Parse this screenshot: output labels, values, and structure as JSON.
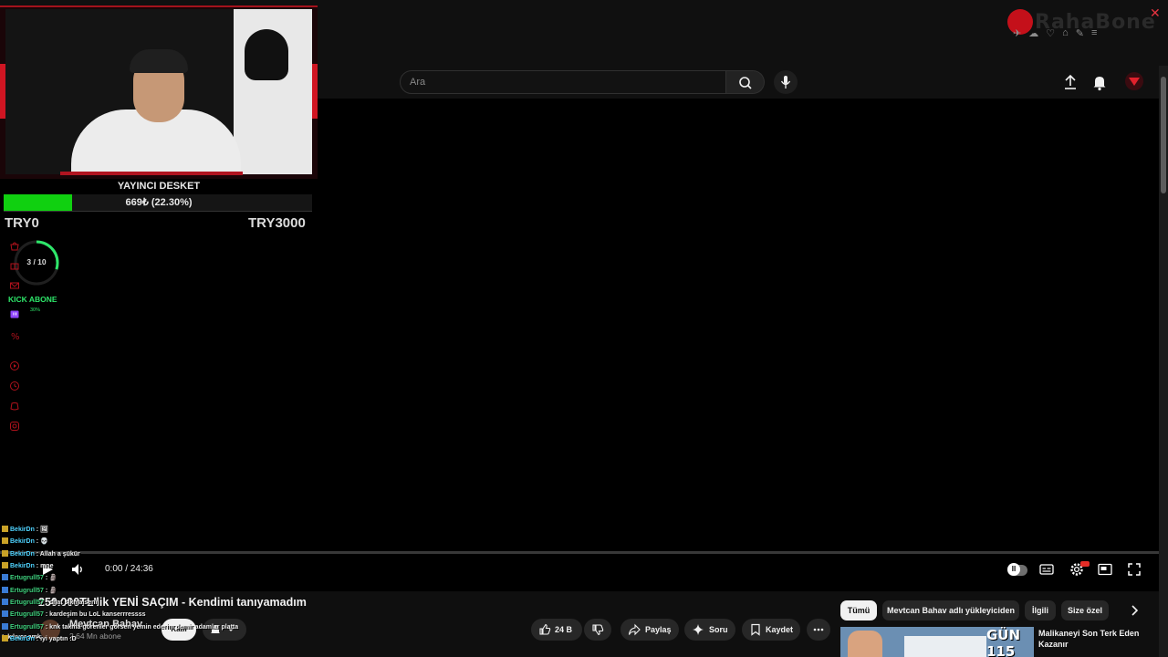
{
  "search": {
    "placeholder": "Ara"
  },
  "brand": {
    "name": "RahaBone"
  },
  "player": {
    "time": "0:00 / 24:36",
    "progress": 0
  },
  "video": {
    "title": "250.000TL'lik YENİ SAÇIM - Kendimi tanıyamadım",
    "channel": "Mevtcan Bahav",
    "subscribers": "2,64 Mn abone",
    "subscribe_label": "Katıl",
    "likes": "24 B",
    "share": "Paylaş",
    "ask": "Soru",
    "save": "Kaydet"
  },
  "chips": [
    "Tümü",
    "Mevtcan Bahav adlı yükleyiciden",
    "İlgili",
    "Size özel"
  ],
  "recommendation": {
    "thumb_text": "GÜN 115",
    "title": "Malikaneyi Son Terk Eden Kazanır"
  },
  "overlay": {
    "goal_title": "YAYINCI DESKET",
    "goal_amount": "669₺ (22.30%)",
    "goal_fraction": 0.223,
    "goal_min": "TRY0",
    "goal_max": "TRY3000",
    "sub_count": "3 / 10",
    "sub_fraction": 0.3,
    "kick_label": "KICK ABONE",
    "kick_pct": "30%"
  },
  "chat": [
    {
      "user": "BekirDn",
      "message": ": 🖼",
      "kind": "user"
    },
    {
      "user": "BekirDn",
      "message": ": 💀",
      "kind": "user"
    },
    {
      "user": "BekirDn",
      "message": ": Allah a şükür",
      "kind": "user"
    },
    {
      "user": "BekirDn",
      "message": ": mne",
      "kind": "user"
    },
    {
      "user": "Ertugrull57",
      "message": ": 🗿",
      "kind": "user2"
    },
    {
      "user": "Ertugrull57",
      "message": ": 🗿",
      "kind": "user2"
    },
    {
      "user": "Ertugrull57",
      "message": ": chat sıkma seni",
      "kind": "user2"
    },
    {
      "user": "Ertugrull57",
      "message": ": kardeşim bu LoL kanserrressss",
      "kind": "user2"
    },
    {
      "user": "Ertugrull57",
      "message": ": knk takma görenler görsen yemin ederim demir adamlar platta takılıyor amk",
      "kind": "user2"
    },
    {
      "user": "BekirDn",
      "message": ": iyi yaptın :D",
      "kind": "user"
    }
  ]
}
